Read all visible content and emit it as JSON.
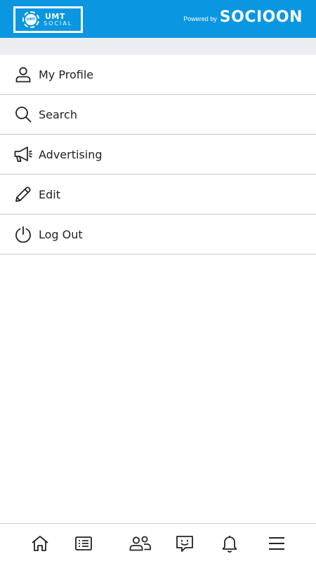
{
  "header": {
    "logo_line1": "UMT",
    "logo_line2": "SOCIAL",
    "logo_emblem_text": "UMT",
    "powered_label": "Powered by",
    "powered_brand": "SOCIOON",
    "background_color": "#0a96e0"
  },
  "menu": {
    "items": [
      {
        "label": "My Profile",
        "icon": "user-icon"
      },
      {
        "label": "Search",
        "icon": "search-icon"
      },
      {
        "label": "Advertising",
        "icon": "megaphone-icon"
      },
      {
        "label": "Edit",
        "icon": "pencil-icon"
      },
      {
        "label": "Log Out",
        "icon": "power-icon"
      }
    ]
  },
  "bottom_nav": {
    "items": [
      {
        "icon": "home-icon"
      },
      {
        "icon": "list-icon"
      },
      {
        "icon": "people-icon"
      },
      {
        "icon": "chat-icon"
      },
      {
        "icon": "bell-icon"
      },
      {
        "icon": "menu-icon"
      }
    ]
  }
}
